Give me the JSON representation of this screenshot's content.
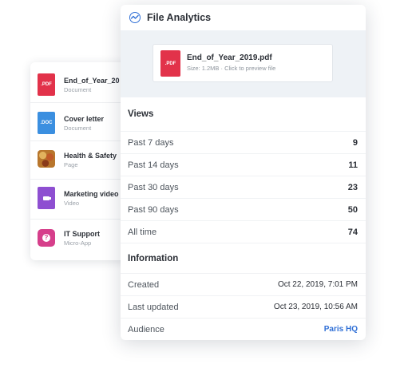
{
  "file_list": {
    "items": [
      {
        "title": "End_of_Year_20",
        "type": "Document",
        "icon": "pdf-file-icon",
        "badge": ".PDF"
      },
      {
        "title": "Cover letter",
        "type": "Document",
        "icon": "doc-file-icon",
        "badge": ".DOC"
      },
      {
        "title": "Health & Safety",
        "type": "Page",
        "icon": "page-thumbnail-icon",
        "badge": ""
      },
      {
        "title": "Marketing video",
        "type": "Video",
        "icon": "video-file-icon",
        "badge": ""
      },
      {
        "title": "IT Support",
        "type": "Micro-App",
        "icon": "micro-app-icon",
        "badge": ""
      }
    ]
  },
  "analytics": {
    "title": "File Analytics",
    "file": {
      "name": "End_of_Year_2019.pdf",
      "meta": "Size: 1.2MB · Click to preview file",
      "badge": ".PDF"
    },
    "views": {
      "heading": "Views",
      "rows": [
        {
          "label": "Past 7 days",
          "value": "9"
        },
        {
          "label": "Past 14 days",
          "value": "11"
        },
        {
          "label": "Past 30 days",
          "value": "23"
        },
        {
          "label": "Past 90 days",
          "value": "50"
        },
        {
          "label": "All time",
          "value": "74"
        }
      ]
    },
    "information": {
      "heading": "Information",
      "rows": [
        {
          "label": "Created",
          "value": "Oct 22, 2019, 7:01 PM"
        },
        {
          "label": "Last updated",
          "value": "Oct 23, 2019, 10:56 AM"
        },
        {
          "label": "Audience",
          "value": "Paris HQ"
        }
      ]
    }
  },
  "colors": {
    "accent": "#2f6fd6",
    "pdf": "#e2324a",
    "doc": "#3b8fe0",
    "video": "#8e4fd1",
    "app": "#d63f8b"
  }
}
